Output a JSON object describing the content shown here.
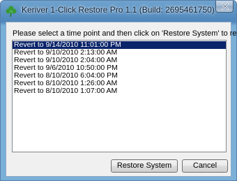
{
  "window": {
    "title": "Keriver 1-Click Restore Pro 1.1 (Build: 2695461750)",
    "icon": "clover-icon",
    "close_icon": "close-icon"
  },
  "dialog": {
    "instruction": "Please select a time point and then click on 'Restore System' to restore.",
    "restore_points": [
      "Revert to 9/14/2010 11:01:00 PM",
      "Revert to 9/10/2010 2:13:00 AM",
      "Revert to 9/10/2010 2:04:00 AM",
      "Revert to 9/6/2010 10:50:00 PM",
      "Revert to 8/10/2010 6:04:00 PM",
      "Revert to 8/10/2010 1:26:00 AM",
      "Revert to 8/10/2010 1:07:00 AM"
    ],
    "selected_index": 0,
    "restore_button": "Restore System",
    "cancel_button": "Cancel"
  },
  "colors": {
    "selection": "#0a246a",
    "titlebar": "#6fa3cf",
    "client": "#f0f0f0",
    "icon_green": "#3a9a3a"
  }
}
